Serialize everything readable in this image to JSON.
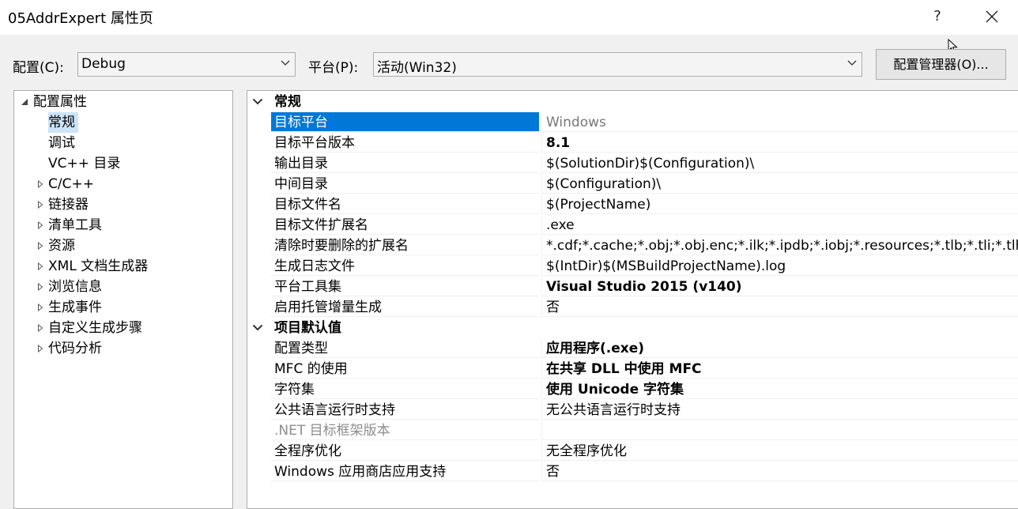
{
  "window": {
    "title": "05AddrExpert 属性页",
    "help": "?"
  },
  "config": {
    "config_label": "配置(C):",
    "config_value": "Debug",
    "platform_label": "平台(P):",
    "platform_value": "活动(Win32)",
    "manager_label": "配置管理器(O)..."
  },
  "tree": {
    "items": [
      {
        "label": "配置属性",
        "expander": "expanded"
      },
      {
        "label": "常规",
        "expander": "none",
        "selected": true
      },
      {
        "label": "调试",
        "expander": "none"
      },
      {
        "label": "VC++ 目录",
        "expander": "none"
      },
      {
        "label": "C/C++",
        "expander": "collapsed"
      },
      {
        "label": "链接器",
        "expander": "collapsed"
      },
      {
        "label": "清单工具",
        "expander": "collapsed"
      },
      {
        "label": "资源",
        "expander": "collapsed"
      },
      {
        "label": "XML 文档生成器",
        "expander": "collapsed"
      },
      {
        "label": "浏览信息",
        "expander": "collapsed"
      },
      {
        "label": "生成事件",
        "expander": "collapsed"
      },
      {
        "label": "自定义生成步骤",
        "expander": "collapsed"
      },
      {
        "label": "代码分析",
        "expander": "collapsed"
      }
    ]
  },
  "grid": {
    "categories": [
      {
        "label": "常规",
        "rows": [
          {
            "name": "目标平台",
            "value": "Windows",
            "selected": true,
            "value_style": "grey"
          },
          {
            "name": "目标平台版本",
            "value": "8.1",
            "value_style": "bold"
          },
          {
            "name": "输出目录",
            "value": "$(SolutionDir)$(Configuration)\\"
          },
          {
            "name": "中间目录",
            "value": "$(Configuration)\\"
          },
          {
            "name": "目标文件名",
            "value": "$(ProjectName)"
          },
          {
            "name": "目标文件扩展名",
            "value": ".exe"
          },
          {
            "name": "清除时要删除的扩展名",
            "value": "*.cdf;*.cache;*.obj;*.obj.enc;*.ilk;*.ipdb;*.iobj;*.resources;*.tlb;*.tli;*.tlh;*.tmp;*.rsp;*.pgc;*.pgd;*.meta;*.tlog;*.manifest;*.res;*.pch;*.exp;*.idb;*.rep;*.xdc;*.pdb;*_manifest.rc;*.bsc;*.sbr;*.xml;*.metagen;*.bi"
          },
          {
            "name": "生成日志文件",
            "value": "$(IntDir)$(MSBuildProjectName).log"
          },
          {
            "name": "平台工具集",
            "value": "Visual Studio 2015 (v140)",
            "value_style": "bold"
          },
          {
            "name": "启用托管增量生成",
            "value": "否"
          }
        ]
      },
      {
        "label": "项目默认值",
        "rows": [
          {
            "name": "配置类型",
            "value": "应用程序(.exe)",
            "value_style": "bold"
          },
          {
            "name": "MFC 的使用",
            "value": "在共享 DLL 中使用 MFC",
            "value_style": "bold"
          },
          {
            "name": "字符集",
            "value": "使用 Unicode 字符集",
            "value_style": "bold"
          },
          {
            "name": "公共语言运行时支持",
            "value": "无公共语言运行时支持"
          },
          {
            "name": ".NET 目标框架版本",
            "value": "",
            "disabled": true
          },
          {
            "name": "全程序优化",
            "value": "无全程序优化"
          },
          {
            "name": "Windows 应用商店应用支持",
            "value": "否"
          }
        ]
      }
    ]
  }
}
